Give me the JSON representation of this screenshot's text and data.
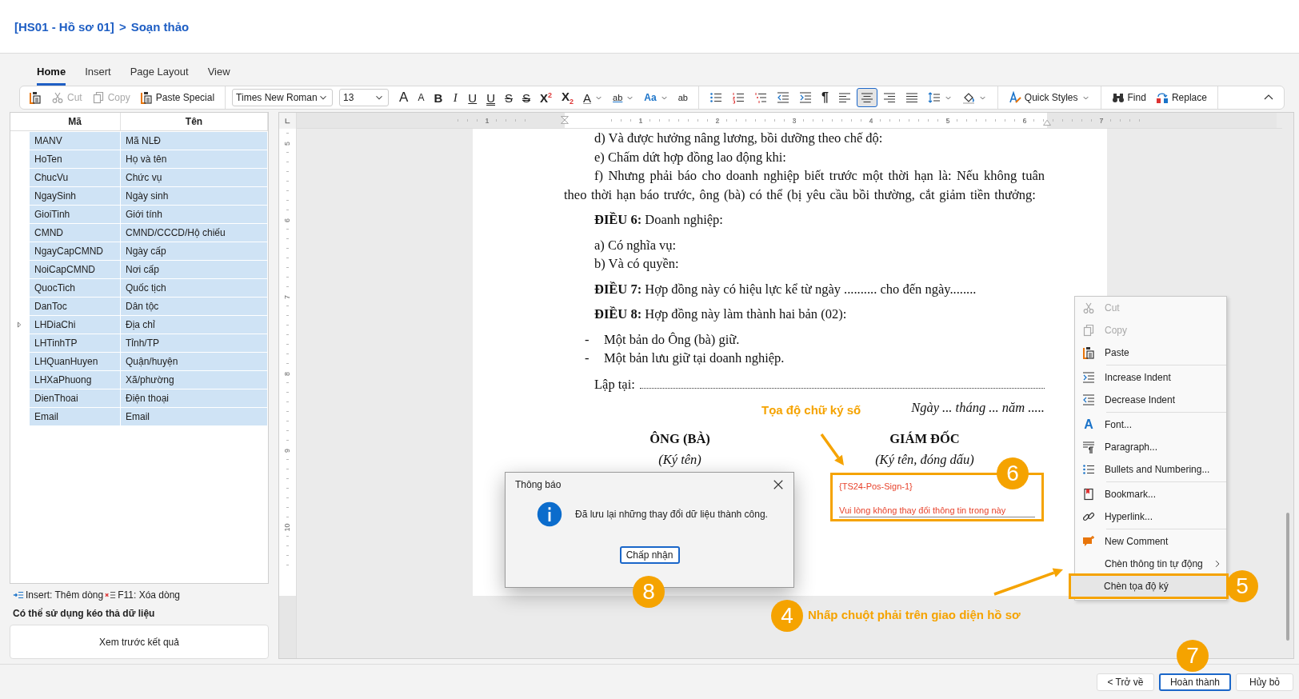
{
  "breadcrumb": {
    "record": "[HS01 - Hồ sơ 01]",
    "separator": ">",
    "page": "Soạn thảo"
  },
  "ribbon_tabs": [
    {
      "label": "Home",
      "selected": true
    },
    {
      "label": "Insert",
      "selected": false
    },
    {
      "label": "Page Layout",
      "selected": false
    },
    {
      "label": "View",
      "selected": false
    }
  ],
  "toolbar": {
    "clipboard": [
      {
        "kind": "paste",
        "disabled": false
      },
      {
        "kind": "cut",
        "label": "Cut",
        "disabled": true
      },
      {
        "kind": "copy",
        "label": "Copy",
        "disabled": true
      },
      {
        "kind": "paste-special",
        "label": "Paste Special",
        "disabled": false
      }
    ],
    "font_name": "Times New Roman",
    "font_size": "13",
    "format_buttons": [
      {
        "kind": "grow",
        "glyph": "A"
      },
      {
        "kind": "shrink",
        "glyph": "A"
      },
      {
        "kind": "bold",
        "glyph": "B"
      },
      {
        "kind": "italic",
        "glyph": "I"
      },
      {
        "kind": "underline",
        "glyph": "U"
      },
      {
        "kind": "double-underline",
        "glyph": "U"
      },
      {
        "kind": "strike",
        "glyph": "S"
      },
      {
        "kind": "double-strike",
        "glyph": "S"
      },
      {
        "kind": "superscript",
        "glyph": "X$^{2}$"
      },
      {
        "kind": "subscript",
        "glyph": "X$_{2}$"
      },
      {
        "kind": "font-color",
        "glyph": "A"
      },
      {
        "kind": "highlight",
        "glyph": "ab"
      },
      {
        "kind": "case",
        "glyph": "Aa"
      },
      {
        "kind": "clear",
        "glyph": "ab"
      }
    ],
    "paragraph_buttons": [
      {
        "kind": "bullets",
        "selected": false
      },
      {
        "kind": "numbering",
        "selected": false
      },
      {
        "kind": "multilevel",
        "selected": false
      },
      {
        "kind": "outdent",
        "selected": false
      },
      {
        "kind": "indent",
        "selected": false
      },
      {
        "kind": "pilcrow",
        "glyph": "¶",
        "selected": false
      },
      {
        "kind": "align-left",
        "selected": false
      },
      {
        "kind": "align-center",
        "selected": true
      },
      {
        "kind": "align-right",
        "selected": false
      },
      {
        "kind": "justify",
        "selected": false
      },
      {
        "kind": "line-spacing",
        "selected": false
      },
      {
        "kind": "shading",
        "selected": false
      }
    ],
    "quick_styles": "Quick Styles",
    "find": "Find",
    "replace": "Replace"
  },
  "ruler": {
    "horizontal": [
      "1",
      "1",
      "2",
      "3",
      "4",
      "5",
      "6",
      "7"
    ],
    "vertical": [
      "5",
      "6",
      "7",
      "8",
      "9",
      "10"
    ]
  },
  "fields_grid": {
    "columns": [
      "Mã",
      "Tên"
    ],
    "rows": [
      {
        "code": "MANV",
        "name": "Mã NLĐ",
        "selected": true,
        "current": false
      },
      {
        "code": "HoTen",
        "name": "Họ và tên",
        "selected": true,
        "current": false
      },
      {
        "code": "ChucVu",
        "name": "Chức vụ",
        "selected": true,
        "current": false
      },
      {
        "code": "NgaySinh",
        "name": "Ngày sinh",
        "selected": true,
        "current": false
      },
      {
        "code": "GioiTinh",
        "name": "Giới tính",
        "selected": true,
        "current": false
      },
      {
        "code": "CMND",
        "name": "CMND/CCCD/Hộ chiếu",
        "selected": true,
        "current": false
      },
      {
        "code": "NgayCapCMND",
        "name": "Ngày cấp",
        "selected": true,
        "current": false
      },
      {
        "code": "NoiCapCMND",
        "name": "Nơi cấp",
        "selected": true,
        "current": false
      },
      {
        "code": "QuocTich",
        "name": "Quốc tịch",
        "selected": true,
        "current": false
      },
      {
        "code": "DanToc",
        "name": "Dân tộc",
        "selected": true,
        "current": false
      },
      {
        "code": "LHDiaChi",
        "name": "Địa chỉ",
        "selected": true,
        "current": true
      },
      {
        "code": "LHTinhTP",
        "name": "Tỉnh/TP",
        "selected": true,
        "current": false
      },
      {
        "code": "LHQuanHuyen",
        "name": "Quận/huyện",
        "selected": true,
        "current": false
      },
      {
        "code": "LHXaPhuong",
        "name": "Xã/phường",
        "selected": true,
        "current": false
      },
      {
        "code": "DienThoai",
        "name": "Điện thoại",
        "selected": true,
        "current": false
      },
      {
        "code": "Email",
        "name": "Email",
        "selected": true,
        "current": false
      }
    ]
  },
  "grid_legend": [
    {
      "kind": "insert",
      "text": "Insert: Thêm dòng"
    },
    {
      "kind": "delete",
      "text": "F11: Xóa dòng"
    }
  ],
  "drag_hint": "Có thể sử dụng kéo thả dữ liệu",
  "preview_button": "Xem trước kết quả",
  "document": {
    "paragraphs": [
      {
        "kind": "item",
        "text": "d) Và được hưởng nâng lương, bồi dưỡng theo chế độ:"
      },
      {
        "kind": "item",
        "text": "e) Chấm dứt hợp đồng lao động khi:"
      },
      {
        "kind": "para",
        "text": "f) Nhưng phải báo cho doanh nghiệp biết trước một thời hạn là: Nếu không tuân theo thời hạn báo trước, ông (bà) có thể (bị yêu cầu bồi thường, cắt giảm tiền thưởng:"
      },
      {
        "kind": "article",
        "text": "**ĐIỀU 6:** Doanh nghiệp:"
      },
      {
        "kind": "item",
        "text": "a) Có nghĩa vụ:"
      },
      {
        "kind": "item",
        "text": "b) Và có quyền:"
      },
      {
        "kind": "article",
        "text": "**ĐIỀU 7:** Hợp đồng này có hiệu lực kể từ ngày .......... cho đến ngày........"
      },
      {
        "kind": "article",
        "text": "**ĐIỀU 8:** Hợp đồng này làm thành hai bản (02):"
      },
      {
        "kind": "bullet",
        "marker": "-",
        "text": "Một bản do Ông (bà) giữ."
      },
      {
        "kind": "bullet",
        "marker": "-",
        "text": "Một bản lưu giữ tại doanh nghiệp."
      },
      {
        "kind": "place",
        "text": "Lập tại:"
      }
    ],
    "date_line": "Ngày ... tháng ... năm .....",
    "signatures": [
      {
        "title": "ÔNG (BÀ)",
        "note": "(Ký tên)"
      },
      {
        "title": "GIÁM ĐỐC",
        "note": "(Ký tên, đóng dấu)",
        "sign_field": {
          "tag": "{TS24-Pos-Sign-1}",
          "warning": "Vui lòng không thay đổi thông tin trong này"
        }
      }
    ]
  },
  "context_menu": [
    {
      "kind": "cut",
      "label": "Cut",
      "disabled": true,
      "selected": false,
      "separator_before": false
    },
    {
      "kind": "copy",
      "label": "Copy",
      "disabled": true,
      "selected": false,
      "separator_before": false
    },
    {
      "kind": "paste",
      "label": "Paste",
      "disabled": false,
      "selected": false,
      "separator_before": false
    },
    {
      "kind": "indent",
      "label": "Increase Indent",
      "disabled": false,
      "selected": false,
      "separator_before": true
    },
    {
      "kind": "outdent",
      "label": "Decrease Indent",
      "disabled": false,
      "selected": false,
      "separator_before": false
    },
    {
      "kind": "font",
      "icon_glyph": "A",
      "label": "Font...",
      "disabled": false,
      "selected": false,
      "separator_before": true
    },
    {
      "kind": "paragraph",
      "label": "Paragraph...",
      "disabled": false,
      "selected": false,
      "separator_before": false
    },
    {
      "kind": "bullets",
      "label": "Bullets and Numbering...",
      "disabled": false,
      "selected": false,
      "separator_before": false
    },
    {
      "kind": "bookmark",
      "label": "Bookmark...",
      "disabled": false,
      "selected": false,
      "separator_before": true
    },
    {
      "kind": "hyperlink",
      "label": "Hyperlink...",
      "disabled": false,
      "selected": false,
      "separator_before": false
    },
    {
      "kind": "comment",
      "label": "New Comment",
      "disabled": false,
      "selected": false,
      "separator_before": true
    },
    {
      "kind": "submenu",
      "label": "Chèn thông tin tự động",
      "disabled": false,
      "selected": false,
      "separator_before": false
    },
    {
      "kind": "plain",
      "label": "Chèn tọa độ ký",
      "disabled": false,
      "selected": true,
      "separator_before": false
    }
  ],
  "dialog": {
    "title": "Thông báo",
    "message": "Đã lưu lại những thay đổi dữ liệu thành công.",
    "button": "Chấp nhận"
  },
  "footer_buttons": [
    {
      "label": "< Trở về",
      "focused": false
    },
    {
      "label": "Hoàn thành",
      "focused": true
    },
    {
      "label": "Hủy bỏ",
      "focused": false
    }
  ],
  "annotations": {
    "label": "Tọa độ chữ ký số",
    "steps": [
      {
        "number": "6"
      },
      {
        "number": "5"
      },
      {
        "number": "8"
      },
      {
        "number": "4",
        "text": "Nhấp chuột phải trên giao diện hồ sơ"
      },
      {
        "number": "7"
      }
    ]
  }
}
